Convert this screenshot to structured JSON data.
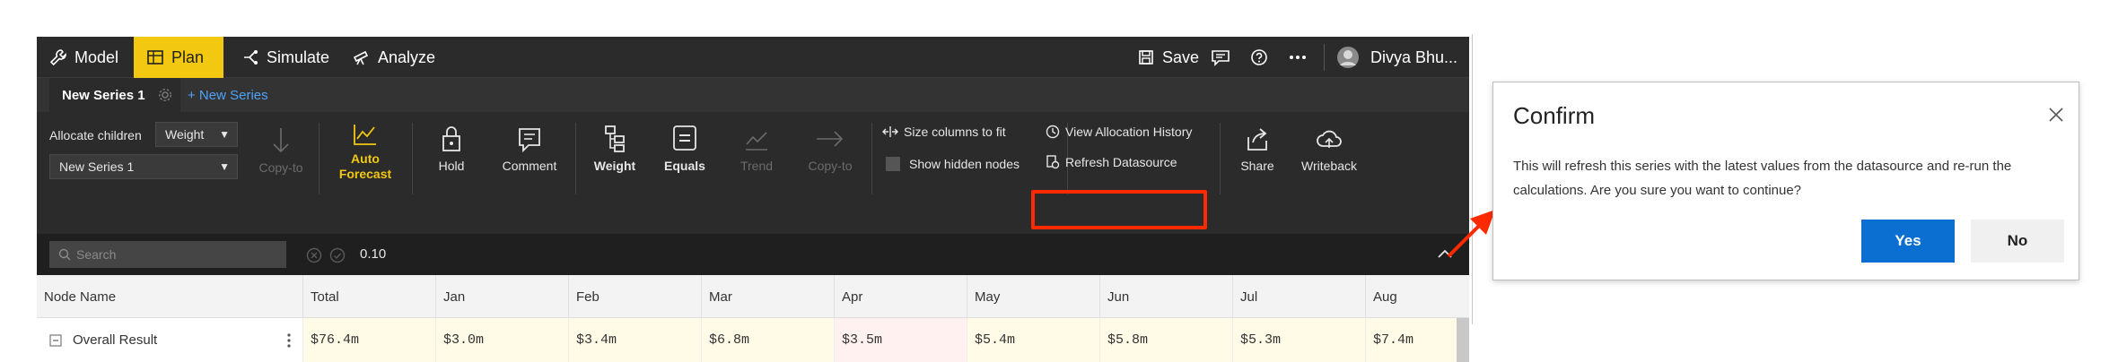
{
  "nav": {
    "model": "Model",
    "plan": "Plan",
    "simulate": "Simulate",
    "analyze": "Analyze",
    "save": "Save",
    "user": "Divya Bhu..."
  },
  "tabs": {
    "active": "New Series 1",
    "new": "+ New Series"
  },
  "ribbon": {
    "allocate_children": "Allocate children",
    "allocate_select": "Weight",
    "series_select": "New Series 1",
    "copy_to": "Copy-to",
    "auto_forecast": "Auto Forecast",
    "hold": "Hold",
    "comment": "Comment",
    "weight": "Weight",
    "equals": "Equals",
    "trend": "Trend",
    "copy_to2": "Copy-to",
    "size_columns": "Size columns to fit",
    "show_hidden": "Show hidden nodes",
    "view_allocation_history": "View Allocation History",
    "refresh_datasource": "Refresh Datasource",
    "share": "Share",
    "writeback": "Writeback"
  },
  "search": {
    "placeholder": "Search",
    "value": "0.10"
  },
  "grid": {
    "headers": [
      "Node Name",
      "Total",
      "Jan",
      "Feb",
      "Mar",
      "Apr",
      "May",
      "Jun",
      "Jul",
      "Aug"
    ],
    "row": {
      "name": "Overall Result",
      "values": [
        "$76.4m",
        "$3.0m",
        "$3.4m",
        "$6.8m",
        "$3.5m",
        "$5.4m",
        "$5.8m",
        "$5.3m",
        "$7.4m"
      ]
    }
  },
  "dialog": {
    "title": "Confirm",
    "message": "This will refresh this series with the latest values from the datasource and re-run the calculations. Are you sure you want to continue?",
    "yes": "Yes",
    "no": "No"
  },
  "colors": {
    "accent_plan": "#f2c811",
    "primary_button": "#0a6fd1",
    "highlight": "#ff2a00"
  }
}
